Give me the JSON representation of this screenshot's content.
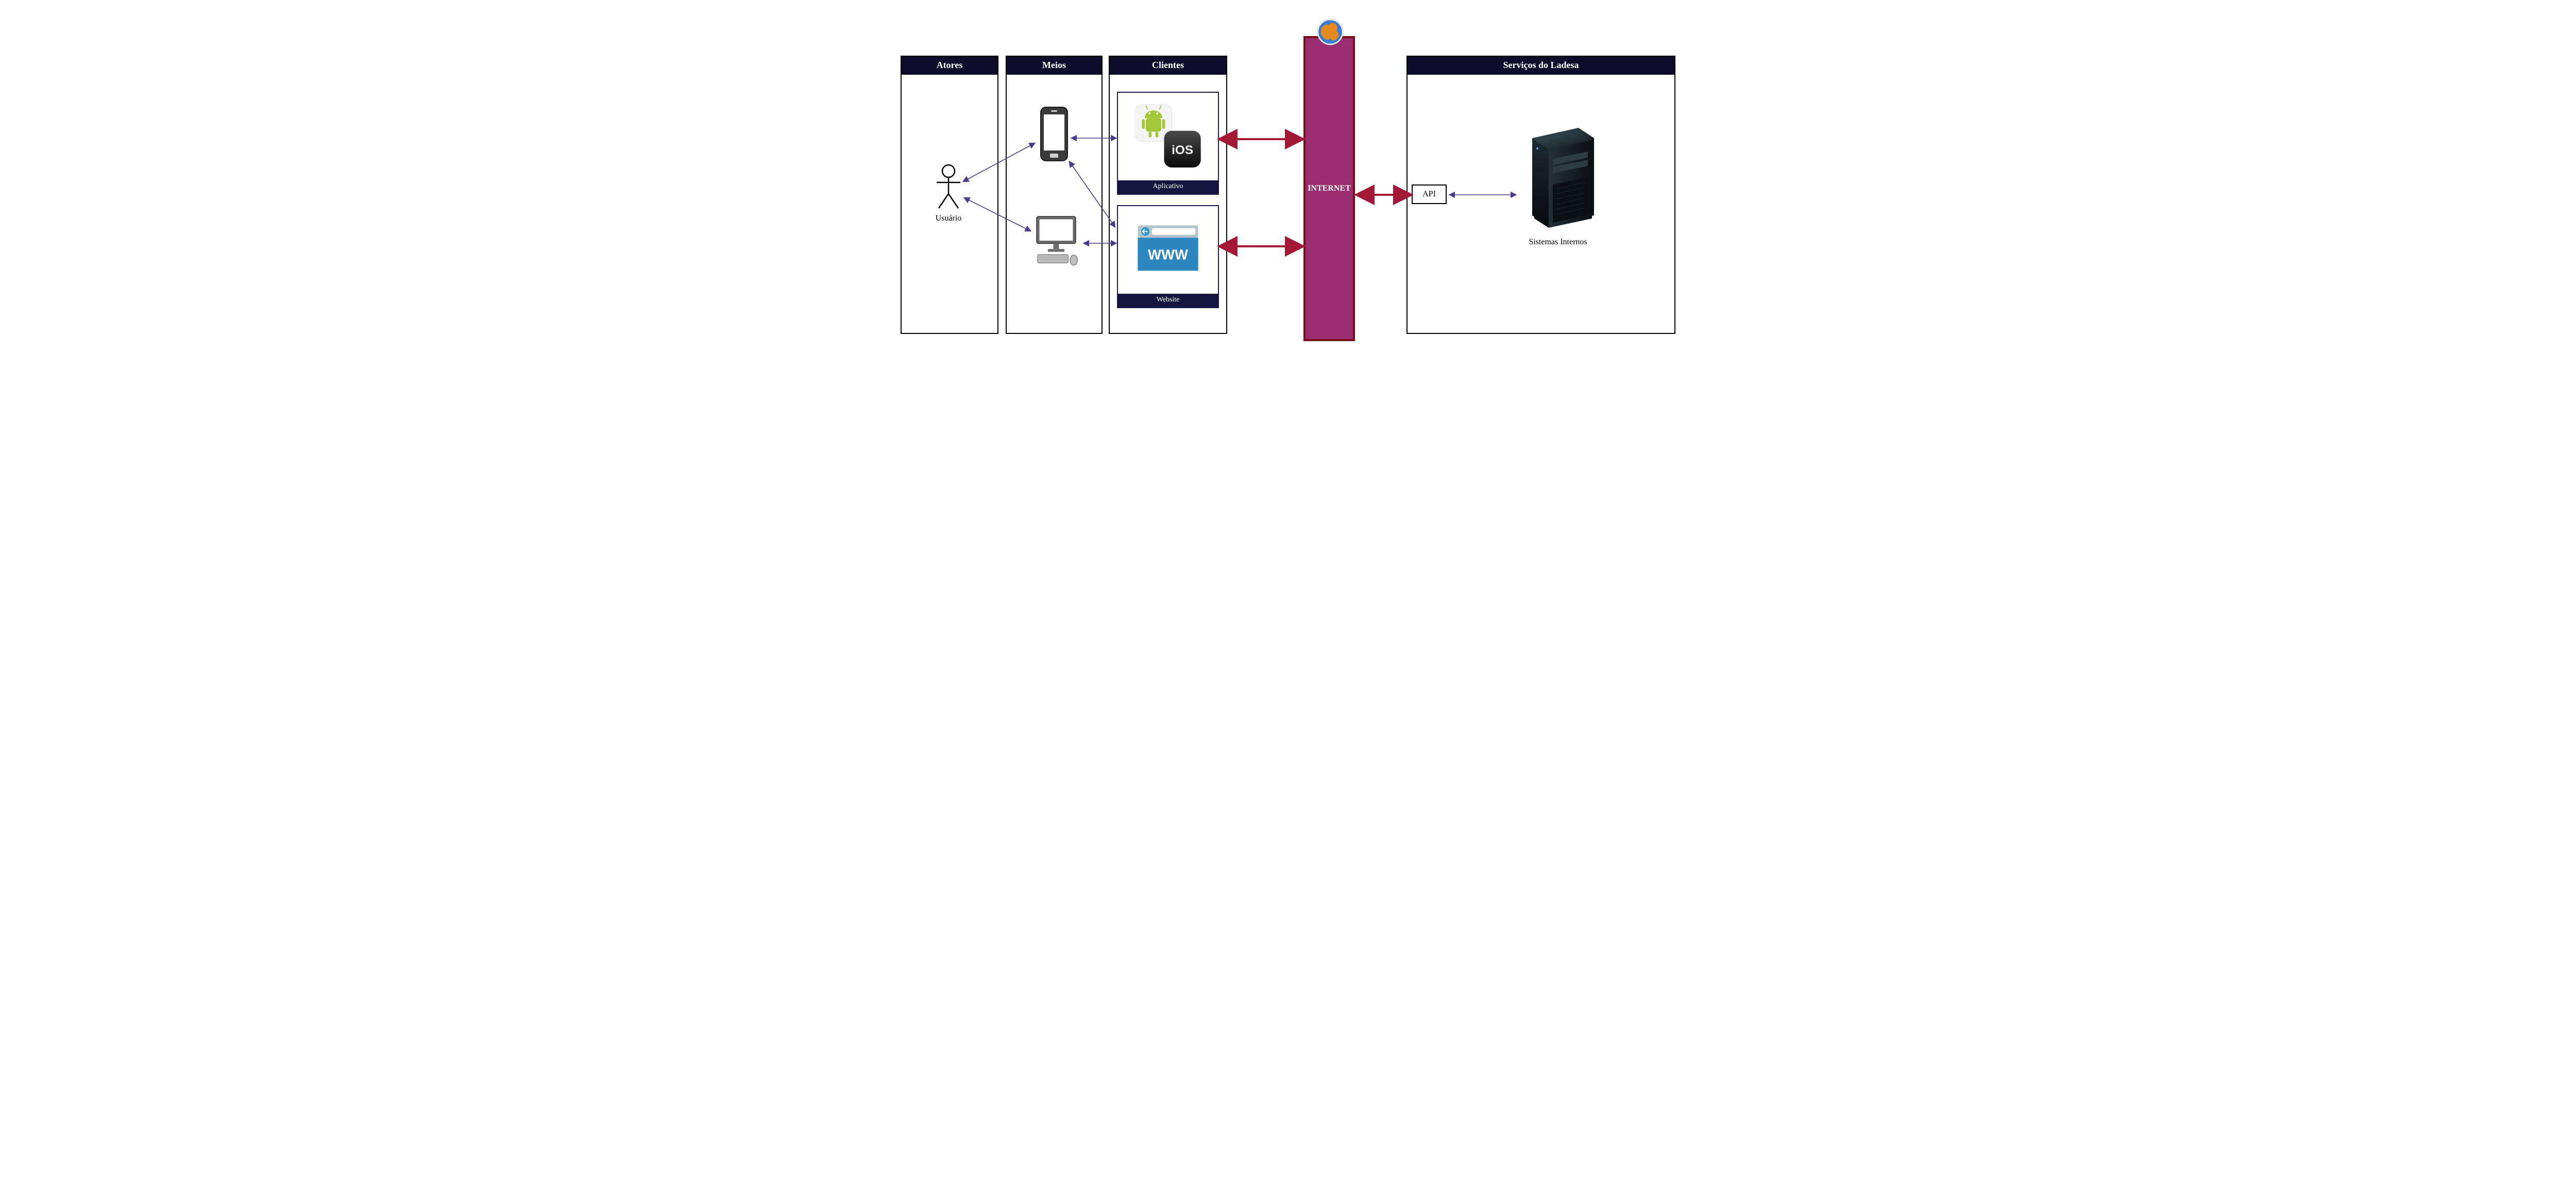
{
  "columns": {
    "atores": "Atores",
    "meios": "Meios",
    "clientes": "Clientes",
    "servicos": "Serviços do Ladesa"
  },
  "internet_label": "INTERNET",
  "clients": {
    "app": "Aplicativo",
    "web": "Website"
  },
  "user_label": "Usuário",
  "api_label": "API",
  "server_label": "Sistemas Internos",
  "colors": {
    "header_bg": "#0d0d2b",
    "client_footer_bg": "#14143f",
    "internet_fill": "#9b2e70",
    "internet_border": "#7a0f18",
    "red_arrow": "#a31836",
    "violet_arrow": "#4b3b8f"
  }
}
